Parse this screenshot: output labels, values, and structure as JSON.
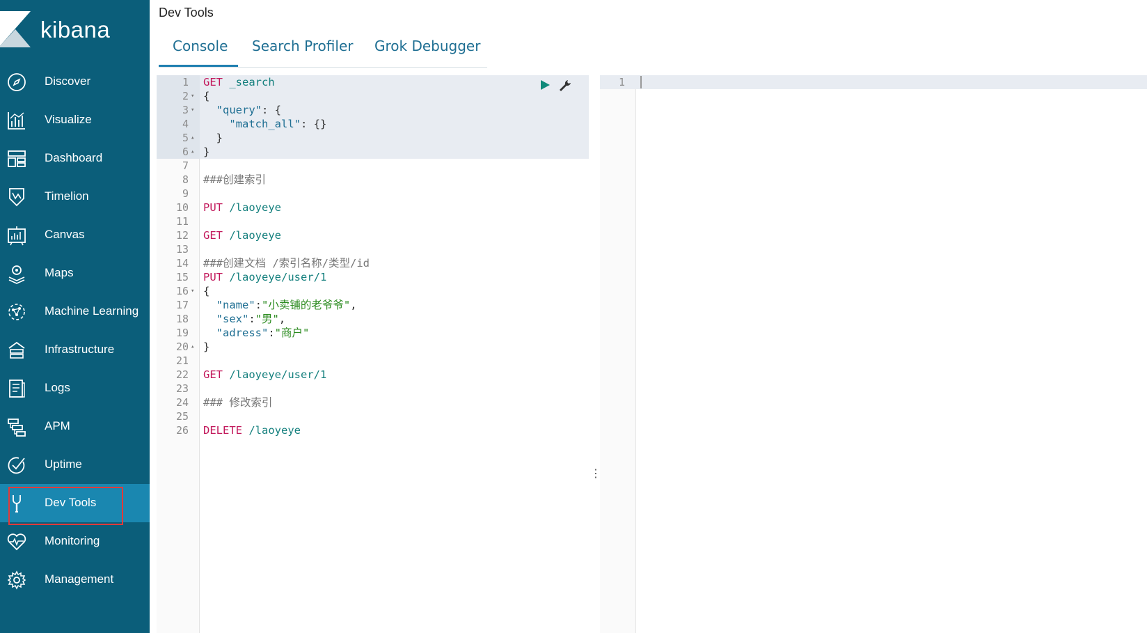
{
  "app": {
    "brand": "kibana",
    "page_title": "Dev Tools"
  },
  "sidebar": {
    "items": [
      {
        "label": "Discover",
        "icon": "compass-icon"
      },
      {
        "label": "Visualize",
        "icon": "chart-icon"
      },
      {
        "label": "Dashboard",
        "icon": "dashboard-icon"
      },
      {
        "label": "Timelion",
        "icon": "timelion-icon"
      },
      {
        "label": "Canvas",
        "icon": "canvas-icon"
      },
      {
        "label": "Maps",
        "icon": "maps-icon"
      },
      {
        "label": "Machine Learning",
        "icon": "machine-learning-icon"
      },
      {
        "label": "Infrastructure",
        "icon": "infrastructure-icon"
      },
      {
        "label": "Logs",
        "icon": "logs-icon"
      },
      {
        "label": "APM",
        "icon": "apm-icon"
      },
      {
        "label": "Uptime",
        "icon": "uptime-icon"
      },
      {
        "label": "Dev Tools",
        "icon": "wrench-icon",
        "active": true
      },
      {
        "label": "Monitoring",
        "icon": "heartbeat-icon"
      },
      {
        "label": "Management",
        "icon": "gear-icon"
      }
    ]
  },
  "tabs": [
    {
      "label": "Console",
      "active": true
    },
    {
      "label": "Search Profiler"
    },
    {
      "label": "Grok Debugger"
    }
  ],
  "editor": {
    "lines": [
      {
        "n": "1",
        "fold": "",
        "parts": [
          [
            "kw",
            "GET"
          ],
          [
            "punc",
            " "
          ],
          [
            "path",
            "_search"
          ]
        ]
      },
      {
        "n": "2",
        "fold": "▾",
        "parts": [
          [
            "punc",
            "{"
          ]
        ]
      },
      {
        "n": "3",
        "fold": "▾",
        "parts": [
          [
            "punc",
            "  "
          ],
          [
            "key",
            "\"query\""
          ],
          [
            "punc",
            ": {"
          ]
        ]
      },
      {
        "n": "4",
        "fold": "",
        "parts": [
          [
            "punc",
            "    "
          ],
          [
            "key",
            "\"match_all\""
          ],
          [
            "punc",
            ": {}"
          ]
        ]
      },
      {
        "n": "5",
        "fold": "▴",
        "parts": [
          [
            "punc",
            "  }"
          ]
        ]
      },
      {
        "n": "6",
        "fold": "▴",
        "parts": [
          [
            "punc",
            "}"
          ]
        ]
      },
      {
        "n": "7",
        "fold": "",
        "parts": []
      },
      {
        "n": "8",
        "fold": "",
        "parts": [
          [
            "cmt",
            "###创建索引"
          ]
        ]
      },
      {
        "n": "9",
        "fold": "",
        "parts": []
      },
      {
        "n": "10",
        "fold": "",
        "parts": [
          [
            "kw",
            "PUT"
          ],
          [
            "punc",
            " "
          ],
          [
            "path",
            "/laoyeye"
          ]
        ]
      },
      {
        "n": "11",
        "fold": "",
        "parts": []
      },
      {
        "n": "12",
        "fold": "",
        "parts": [
          [
            "kw",
            "GET"
          ],
          [
            "punc",
            " "
          ],
          [
            "path",
            "/laoyeye"
          ]
        ]
      },
      {
        "n": "13",
        "fold": "",
        "parts": []
      },
      {
        "n": "14",
        "fold": "",
        "parts": [
          [
            "cmt",
            "###创建文档 /索引名称/类型/id"
          ]
        ]
      },
      {
        "n": "15",
        "fold": "",
        "parts": [
          [
            "kw",
            "PUT"
          ],
          [
            "punc",
            " "
          ],
          [
            "path",
            "/laoyeye/user/1"
          ]
        ]
      },
      {
        "n": "16",
        "fold": "▾",
        "parts": [
          [
            "punc",
            "{"
          ]
        ]
      },
      {
        "n": "17",
        "fold": "",
        "parts": [
          [
            "punc",
            "  "
          ],
          [
            "key",
            "\"name\""
          ],
          [
            "punc",
            ":"
          ],
          [
            "str",
            "\"小卖铺的老爷爷\""
          ],
          [
            "punc",
            ","
          ]
        ]
      },
      {
        "n": "18",
        "fold": "",
        "parts": [
          [
            "punc",
            "  "
          ],
          [
            "key",
            "\"sex\""
          ],
          [
            "punc",
            ":"
          ],
          [
            "str",
            "\"男\""
          ],
          [
            "punc",
            ","
          ]
        ]
      },
      {
        "n": "19",
        "fold": "",
        "parts": [
          [
            "punc",
            "  "
          ],
          [
            "key",
            "\"adress\""
          ],
          [
            "punc",
            ":"
          ],
          [
            "str",
            "\"商户\""
          ]
        ]
      },
      {
        "n": "20",
        "fold": "▴",
        "parts": [
          [
            "punc",
            "}"
          ]
        ]
      },
      {
        "n": "21",
        "fold": "",
        "parts": []
      },
      {
        "n": "22",
        "fold": "",
        "parts": [
          [
            "kw",
            "GET"
          ],
          [
            "punc",
            " "
          ],
          [
            "path",
            "/laoyeye/user/1"
          ]
        ]
      },
      {
        "n": "23",
        "fold": "",
        "parts": []
      },
      {
        "n": "24",
        "fold": "",
        "parts": [
          [
            "cmt",
            "### 修改索引"
          ]
        ]
      },
      {
        "n": "25",
        "fold": "",
        "parts": []
      },
      {
        "n": "26",
        "fold": "",
        "parts": [
          [
            "kw",
            "DELETE"
          ],
          [
            "punc",
            " "
          ],
          [
            "path",
            "/laoyeye"
          ]
        ]
      }
    ]
  },
  "output": {
    "line_number": "1"
  },
  "colors": {
    "sidebar_bg": "#0b5e7a",
    "active_bg": "#1a87b0",
    "accent": "#1f6f93",
    "keyword": "#c2185b",
    "path": "#15807e",
    "string": "#2a8a1e",
    "highlight_outline": "#e23a3a"
  }
}
